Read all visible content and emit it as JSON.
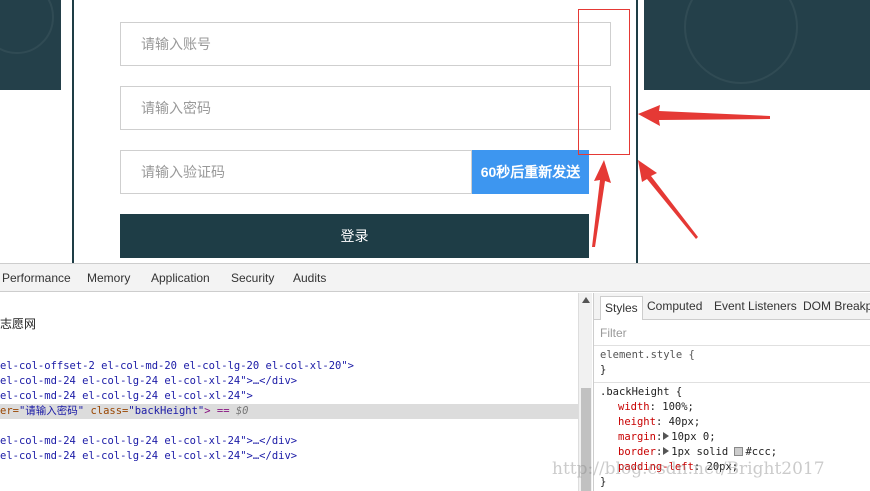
{
  "login_form": {
    "account_placeholder": "请输入账号",
    "password_placeholder": "请输入密码",
    "code_placeholder": "请输入验证码",
    "send_button": "60秒后重新发送",
    "login_button": "登录"
  },
  "devtools": {
    "tabs": [
      "Performance",
      "Memory",
      "Application",
      "Security",
      "Audits"
    ],
    "breadcrumb": "志愿网",
    "code_lines": [
      {
        "pre": "el-col-offset-2 el-col-md-20 el-col-lg-20 el-col-xl-20\">",
        "post": ""
      },
      {
        "pre": "el-col-md-24 el-col-lg-24 el-col-xl-24\">…</div>",
        "post": ""
      },
      {
        "pre": "el-col-md-24 el-col-lg-24 el-col-xl-24\">",
        "post": ""
      },
      {
        "pre": "el-col-md-24 el-col-lg-24 el-col-xl-24\">…</div>",
        "post": ""
      },
      {
        "pre": "el-col-md-24 el-col-lg-24 el-col-xl-24\">…</div>",
        "post": ""
      }
    ],
    "selected_line": {
      "attr_start": "er=",
      "placeholder_value": "\"请输入密码\"",
      "class_attr": " class=",
      "class_value": "\"backHeight\"",
      "tail": "> == ",
      "ref": "$0"
    },
    "styles_tabs": [
      "Styles",
      "Computed",
      "Event Listeners",
      "DOM Breakpoints"
    ],
    "filter_placeholder": "Filter",
    "element_style_open": "element.style {",
    "element_style_close": "}",
    "rule_selector": ".backHeight {",
    "rule_props": [
      {
        "name": "width",
        "value": " 100%;"
      },
      {
        "name": "height",
        "value": " 40px;"
      },
      {
        "name": "margin",
        "value": "10px 0;"
      },
      {
        "name": "border",
        "value": "1px solid "
      },
      {
        "name": "padding-left",
        "value": " 20px;"
      }
    ],
    "border_color": "#ccc;",
    "rule_close": "}"
  },
  "watermark": "http://blog.csdn.net/Bright2017",
  "colors": {
    "brand_dark": "#1e3d46",
    "send_blue": "#3d96f0",
    "annotation_red": "#e53935"
  }
}
